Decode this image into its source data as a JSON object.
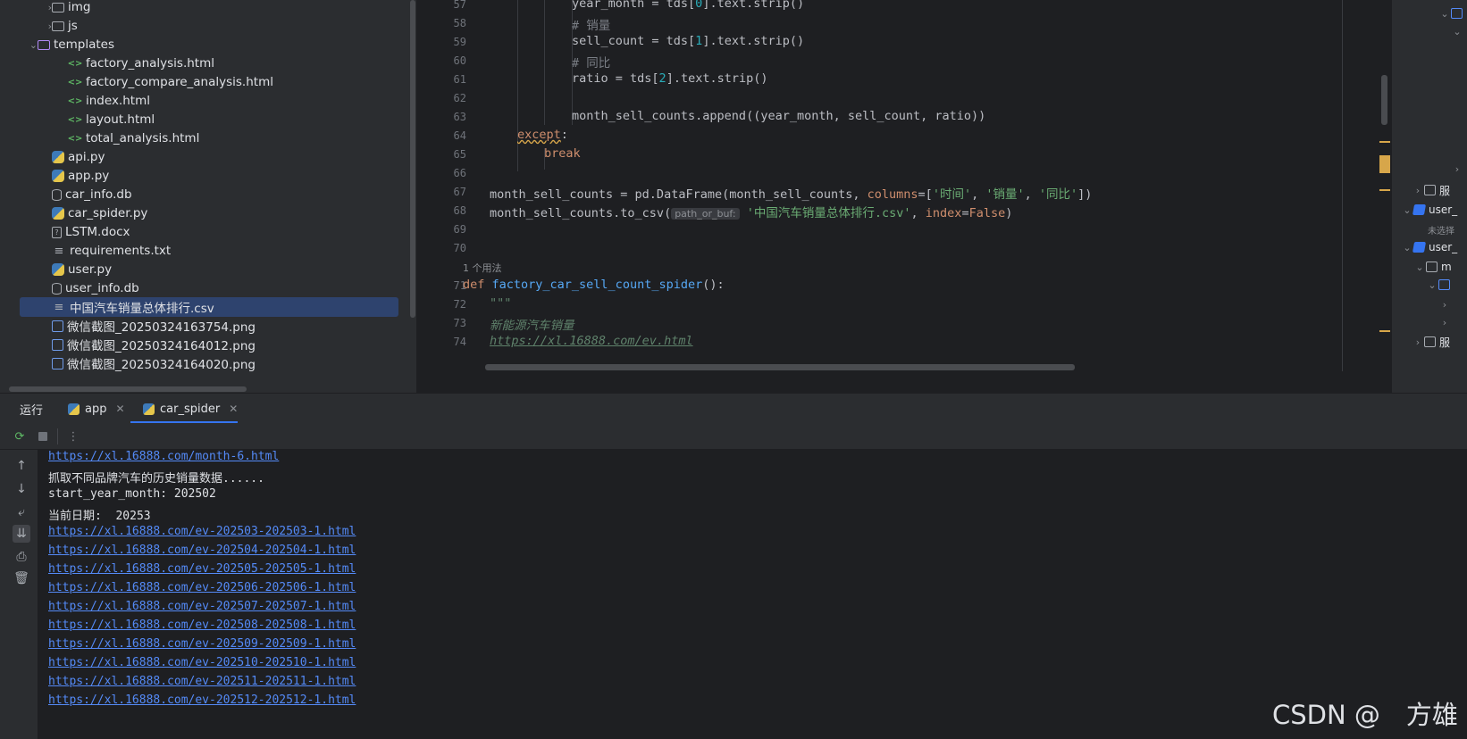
{
  "project_tree": {
    "items": [
      {
        "label": "img",
        "type": "folder",
        "depth": 2,
        "chevron": "›"
      },
      {
        "label": "js",
        "type": "folder",
        "depth": 2,
        "chevron": "›"
      },
      {
        "label": "templates",
        "type": "folder-purple",
        "depth": 1,
        "chevron": "⌄"
      },
      {
        "label": "factory_analysis.html",
        "type": "html",
        "depth": 3
      },
      {
        "label": "factory_compare_analysis.html",
        "type": "html",
        "depth": 3
      },
      {
        "label": "index.html",
        "type": "html",
        "depth": 3
      },
      {
        "label": "layout.html",
        "type": "html",
        "depth": 3
      },
      {
        "label": "total_analysis.html",
        "type": "html",
        "depth": 3
      },
      {
        "label": "api.py",
        "type": "py",
        "depth": 2
      },
      {
        "label": "app.py",
        "type": "py",
        "depth": 2
      },
      {
        "label": "car_info.db",
        "type": "db",
        "depth": 2
      },
      {
        "label": "car_spider.py",
        "type": "py",
        "depth": 2
      },
      {
        "label": "LSTM.docx",
        "type": "doc",
        "depth": 2
      },
      {
        "label": "requirements.txt",
        "type": "txt",
        "depth": 2
      },
      {
        "label": "user.py",
        "type": "py",
        "depth": 2
      },
      {
        "label": "user_info.db",
        "type": "db",
        "depth": 2
      },
      {
        "label": "中国汽车销量总体排行.csv",
        "type": "txt",
        "depth": 2,
        "selected": true
      },
      {
        "label": "微信截图_20250324163754.png",
        "type": "img",
        "depth": 2
      },
      {
        "label": "微信截图_20250324164012.png",
        "type": "img",
        "depth": 2
      },
      {
        "label": "微信截图_20250324164020.png",
        "type": "img",
        "depth": 2
      }
    ]
  },
  "editor": {
    "line_numbers": [
      "57",
      "58",
      "59",
      "60",
      "61",
      "62",
      "63",
      "64",
      "65",
      "66",
      "67",
      "68",
      "69",
      "70",
      "71",
      "72",
      "73",
      "74"
    ],
    "usage_hint": "1 个用法",
    "param_hint": "path_or_buf:",
    "lines": {
      "l57": {
        "pre": "year_month = tds[",
        "num": "0",
        "post": "].text.strip()"
      },
      "l58": "# 销量",
      "l59": {
        "pre": "sell_count = tds[",
        "num": "1",
        "post": "].text.strip()"
      },
      "l60": "# 同比",
      "l61": {
        "pre": "ratio = tds[",
        "num": "2",
        "post": "].text.strip()"
      },
      "l63": "month_sell_counts.append((year_month, sell_count, ratio))",
      "l64": "except",
      "l64_colon": ":",
      "l65": "break",
      "l67": {
        "pre": "month_sell_counts = pd.DataFrame(month_sell_counts, ",
        "kwarg": "columns",
        "eq": "=[",
        "s1": "'时间'",
        "c1": ", ",
        "s2": "'销量'",
        "c2": ", ",
        "s3": "'同比'",
        "post": "])"
      },
      "l68": {
        "pre": "month_sell_counts.to_csv(",
        "str": "'中国汽车销量总体排行.csv'",
        "comma": ", ",
        "kwarg": "index",
        "eq": "=",
        "val": "False",
        "post": ")"
      },
      "l71": {
        "kw": "def ",
        "fn": "factory_car_sell_count_spider",
        "post": "():"
      },
      "l72": "\"\"\"",
      "l73": "新能源汽车销量",
      "l74": "https://xl.16888.com/ev.html"
    }
  },
  "right_panel": {
    "items": [
      {
        "label": "服",
        "icon": "grey",
        "chevron": "›"
      },
      {
        "label": "user_",
        "icon": "db",
        "chevron": "⌄"
      },
      {
        "label": "未选择",
        "small": true
      },
      {
        "label": "user_",
        "icon": "db",
        "chevron": "⌄"
      },
      {
        "label": "m",
        "icon": "grey",
        "chevron": "⌄"
      },
      {
        "label": "服",
        "icon": "grey",
        "chevron": "›"
      }
    ]
  },
  "run_panel": {
    "title": "运行",
    "tabs": [
      {
        "label": "app"
      },
      {
        "label": "car_spider",
        "active": true
      }
    ],
    "console_lines": [
      {
        "text": "https://xl.16888.com/month-6.html",
        "link": true
      },
      {
        "text": "抓取不同品牌汽车的历史销量数据......",
        "link": false
      },
      {
        "text": "start_year_month: 202502",
        "link": false
      },
      {
        "text": "当前日期:  20253",
        "link": false
      },
      {
        "text": "https://xl.16888.com/ev-202503-202503-1.html",
        "link": true
      },
      {
        "text": "https://xl.16888.com/ev-202504-202504-1.html",
        "link": true
      },
      {
        "text": "https://xl.16888.com/ev-202505-202505-1.html",
        "link": true
      },
      {
        "text": "https://xl.16888.com/ev-202506-202506-1.html",
        "link": true
      },
      {
        "text": "https://xl.16888.com/ev-202507-202507-1.html",
        "link": true
      },
      {
        "text": "https://xl.16888.com/ev-202508-202508-1.html",
        "link": true
      },
      {
        "text": "https://xl.16888.com/ev-202509-202509-1.html",
        "link": true
      },
      {
        "text": "https://xl.16888.com/ev-202510-202510-1.html",
        "link": true
      },
      {
        "text": "https://xl.16888.com/ev-202511-202511-1.html",
        "link": true
      },
      {
        "text": "https://xl.16888.com/ev-202512-202512-1.html",
        "link": true
      }
    ]
  },
  "watermark": "CSDN @　方雄"
}
